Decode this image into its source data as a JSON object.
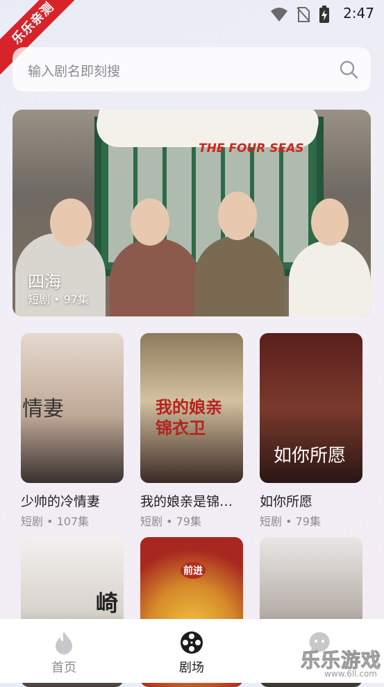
{
  "status": {
    "time": "2:47"
  },
  "ribbon": {
    "text": "乐乐亲测"
  },
  "search": {
    "placeholder": "输入剧名即刻搜"
  },
  "banner": {
    "logo_title": "四海",
    "english_title": "THE FOUR SEAS",
    "title": "四海",
    "meta": "短剧 • 97集"
  },
  "cards": [
    {
      "title": "少帅的冷情妻",
      "meta": "短剧 • 107集",
      "poster_text": "情妻"
    },
    {
      "title": "我的娘亲是锦…",
      "meta": "短剧 • 79集",
      "poster_text": "我的娘亲 锦衣卫"
    },
    {
      "title": "如你所愿",
      "meta": "短剧 • 79集",
      "poster_text": "如你所愿"
    },
    {
      "title": "",
      "meta": "",
      "poster_text": "崎"
    },
    {
      "title": "",
      "meta": "",
      "poster_text": "前进"
    },
    {
      "title": "",
      "meta": "",
      "poster_text": ""
    }
  ],
  "tabs": [
    {
      "label": "首页",
      "icon": "flame-icon",
      "active": false
    },
    {
      "label": "剧场",
      "icon": "film-reel-icon",
      "active": true
    },
    {
      "label": "",
      "icon": "chat-face-icon",
      "active": false
    }
  ],
  "watermark": {
    "text": "乐乐游戏",
    "url": "www.6ll.com"
  },
  "colors": {
    "accent": "#d8232a",
    "active_tab": "#1c1c1c",
    "inactive_tab": "#8c8c90"
  }
}
